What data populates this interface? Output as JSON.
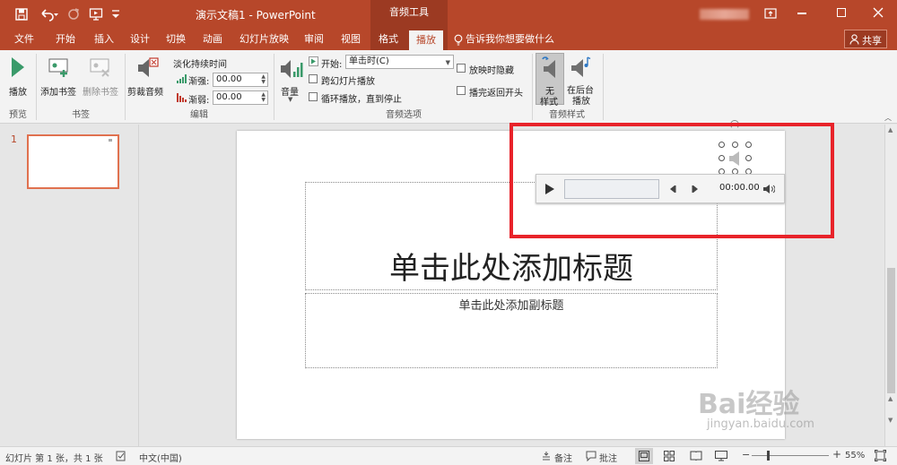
{
  "window": {
    "doc_title": "演示文稿1 - PowerPoint",
    "context_tool": "音频工具",
    "share_label": "共享"
  },
  "tabs": [
    "文件",
    "开始",
    "插入",
    "设计",
    "切换",
    "动画",
    "幻灯片放映",
    "审阅",
    "视图",
    "格式",
    "播放"
  ],
  "tell_me": "告诉我你想要做什么",
  "ribbon": {
    "play": "播放",
    "add_bookmark": "添加书签",
    "remove_bookmark": "删除书签",
    "trim_audio": "剪裁音频",
    "fade_duration": "淡化持续时间",
    "fade_in_label": "渐强:",
    "fade_in_value": "00.00",
    "fade_out_label": "渐弱:",
    "fade_out_value": "00.00",
    "volume": "音量",
    "start_label": "开始:",
    "start_value": "单击时(C)",
    "play_across_slides": "跨幻灯片播放",
    "loop_until_stopped": "循环播放，直到停止",
    "hide_during_show": "放映时隐藏",
    "rewind_after_playing": "播完返回开头",
    "no_style_1": "无",
    "no_style_2": "样式",
    "play_in_bg_1": "在后台",
    "play_in_bg_2": "播放",
    "groups": {
      "preview": "预览",
      "bookmarks": "书签",
      "editing": "编辑",
      "audio_options": "音频选项",
      "audio_styles": "音频样式"
    }
  },
  "thumbnail_number": "1",
  "slide": {
    "title_placeholder": "单击此处添加标题",
    "subtitle_placeholder": "单击此处添加副标题"
  },
  "player": {
    "time": "00:00.00"
  },
  "status": {
    "slide_info": "幻灯片 第 1 张，共 1 张",
    "language": "中文(中国)",
    "notes": "备注",
    "comments": "批注",
    "zoom": "55%"
  },
  "watermark": {
    "brand": "Bai经验",
    "url": "jingyan.baidu.com"
  },
  "colors": {
    "accent": "#b7472a",
    "highlight_box": "#e8232a"
  }
}
